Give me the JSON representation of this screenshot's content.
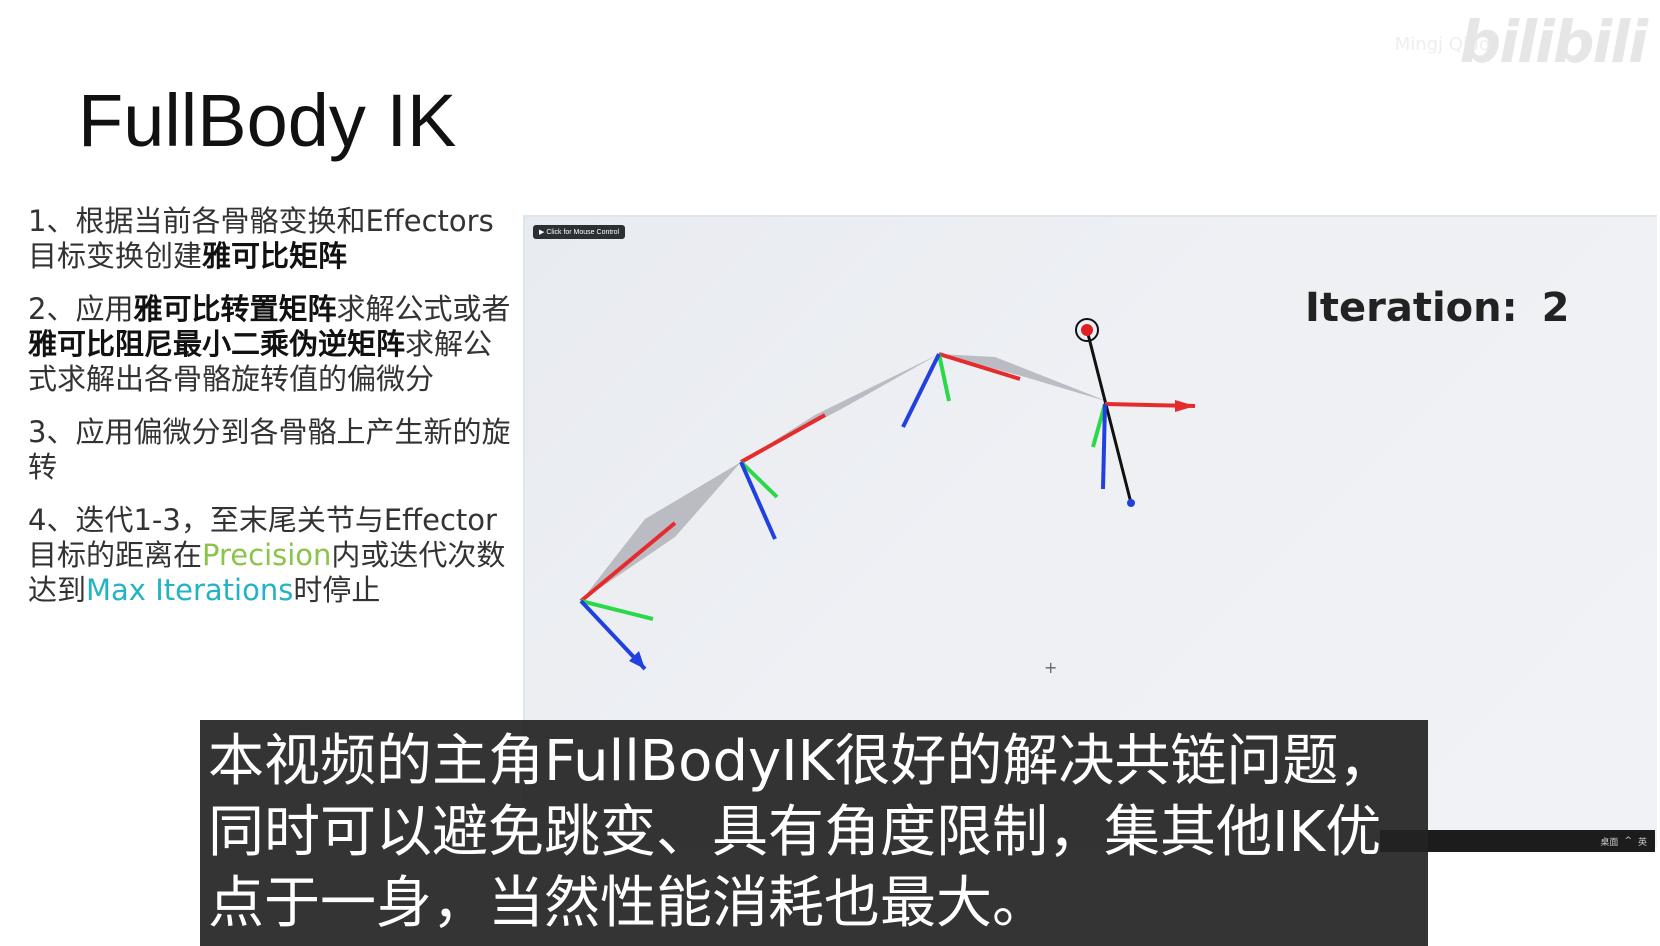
{
  "watermark": {
    "logo_text": "bilibili",
    "user_text": "Mingj Qiao"
  },
  "slide": {
    "title": "FullBody IK",
    "steps": [
      {
        "parts": [
          {
            "t": "1、根据当前各骨骼变换和Effectors目标变换创建"
          },
          {
            "t": "雅可比矩阵",
            "s": "bold"
          }
        ]
      },
      {
        "parts": [
          {
            "t": "2、应用"
          },
          {
            "t": "雅可比转置矩阵",
            "s": "bold"
          },
          {
            "t": "求解公式或者"
          },
          {
            "t": "雅可比阻尼最小二乘伪逆矩阵",
            "s": "bold"
          },
          {
            "t": "求解公式求解出各骨骼旋转值的偏微分"
          }
        ]
      },
      {
        "parts": [
          {
            "t": "3、应用偏微分到各骨骼上产生新的旋转"
          }
        ]
      },
      {
        "parts": [
          {
            "t": "4、迭代1-3，至末尾关节与Effector目标的距离在"
          },
          {
            "t": "Precision",
            "s": "green"
          },
          {
            "t": "内或迭代次数达到"
          },
          {
            "t": "Max Iterations",
            "s": "cyan"
          },
          {
            "t": "时停止"
          }
        ]
      }
    ]
  },
  "viewport": {
    "mouse_button": "▶  Click for Mouse Control",
    "iteration_label": "Iteration:",
    "iteration_value": "2",
    "colors": {
      "x_axis": "#e52b2b",
      "y_axis": "#2bd84a",
      "z_axis": "#2040e0",
      "bone": "#9a9aa4",
      "target": "#e02020"
    }
  },
  "taskbar": {
    "items": [
      "桌面",
      "^",
      "英"
    ]
  },
  "subtitle": {
    "lines": [
      "本视频的主角FullBodyIK很好的解决共链问题，",
      "同时可以避免跳变、具有角度限制，集其他IK优",
      "点于一身，当然性能消耗也最大。"
    ]
  }
}
